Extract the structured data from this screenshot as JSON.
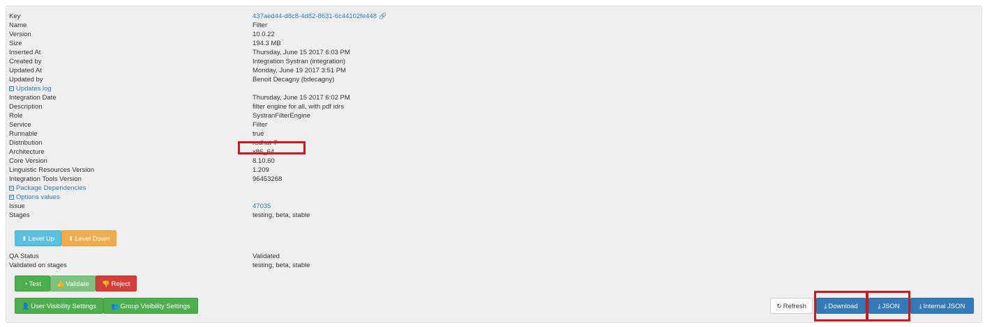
{
  "details": [
    {
      "label": "Key",
      "value": "437aed44-d8c8-4d82-8631-6c44102fe448",
      "kind": "link"
    },
    {
      "label": "Name",
      "value": "Filter"
    },
    {
      "label": "Version",
      "value": "10.0.22"
    },
    {
      "label": "Size",
      "value": "194.3 MB"
    },
    {
      "label": "Inserted At",
      "value": "Thursday, June 15 2017 6:03 PM"
    },
    {
      "label": "Created by",
      "value": "Integration Systran (integration)"
    },
    {
      "label": "Updated At",
      "value": "Monday, June 19 2017 3:51 PM"
    },
    {
      "label": "Updated by",
      "value": "Benoit Decagny (bdecagny)"
    },
    {
      "label": "Updates log",
      "value": "",
      "kind": "toggle"
    },
    {
      "label": "Integration Date",
      "value": "Thursday, June 15 2017 6:02 PM"
    },
    {
      "label": "Description",
      "value": "filter engine for all, with pdf idrs"
    },
    {
      "label": "Role",
      "value": "SystranFilterEngine"
    },
    {
      "label": "Service",
      "value": "Filter"
    },
    {
      "label": "Runnable",
      "value": "true"
    },
    {
      "label": "Distribution",
      "value": "redhat-7"
    },
    {
      "label": "Architecture",
      "value": "x86_64"
    },
    {
      "label": "Core Version",
      "value": "8.10.60"
    },
    {
      "label": "Linguistic Resources Version",
      "value": "1.209"
    },
    {
      "label": "Integration Tools Version",
      "value": "96453268"
    },
    {
      "label": "Package Dependencies",
      "value": "",
      "kind": "toggle"
    },
    {
      "label": "Options values",
      "value": "",
      "kind": "toggle"
    },
    {
      "label": "Issue",
      "value": "47035",
      "kind": "link-value"
    },
    {
      "label": "Stages",
      "value": "testing, beta, stable"
    }
  ],
  "qa": [
    {
      "label": "QA Status",
      "value": "Validated"
    },
    {
      "label": "Validated on stages",
      "value": "testing, beta, stable"
    }
  ],
  "buttons": {
    "level_up": "Level Up",
    "level_down": "Level Down",
    "test": "Test",
    "validate": "Validate",
    "reject": "Reject",
    "user_visibility": "User Visibility Settings",
    "group_visibility": "Group Visibility Settings",
    "refresh": "Refresh",
    "download": "Download",
    "json": "JSON",
    "internal_json": "Internal JSON"
  },
  "icons": {
    "key_link": "link-icon",
    "toggle": "expand-icon",
    "level_up": "arrow-up-icon",
    "level_down": "arrow-down-icon",
    "test": "dashboard-icon",
    "validate": "thumbs-up-icon",
    "reject": "thumbs-down-icon",
    "user": "user-icon",
    "group": "users-icon",
    "refresh": "refresh-icon",
    "download": "download-icon"
  },
  "colors": {
    "highlight": "#d0181f",
    "link": "#337ab7",
    "info": "#5bc0de",
    "warning": "#f0ad4e",
    "success": "#4cae4c",
    "danger": "#d43f3a",
    "primary": "#337ab7"
  }
}
